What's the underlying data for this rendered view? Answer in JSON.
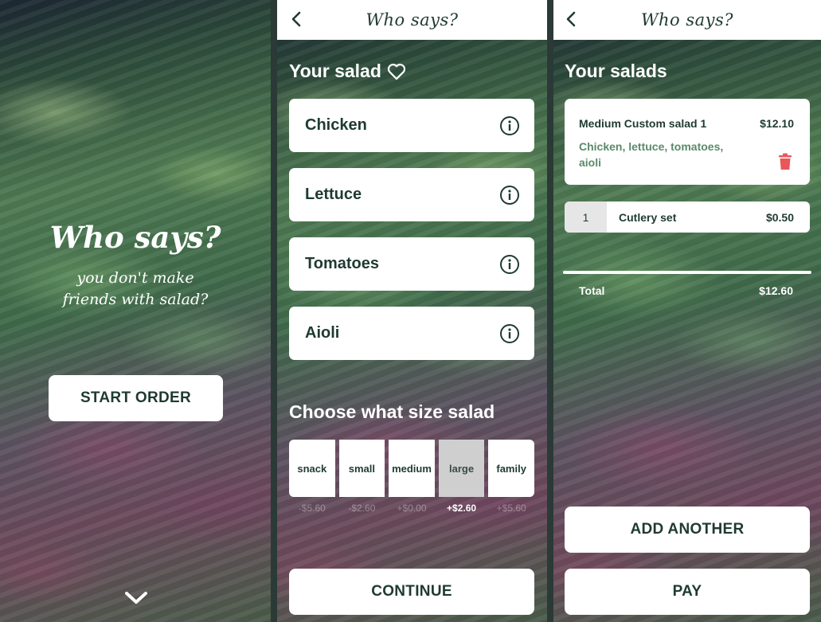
{
  "colors": {
    "brand_green": "#1f3a33",
    "card_white": "#ffffff",
    "selected_size_bg": "#cfcfcf",
    "desc_green": "#5a8a6a",
    "trash_red": "#e8575a"
  },
  "landing": {
    "title": "Who says?",
    "subtitle": "you don't make friends with salad?",
    "start_button": "START ORDER",
    "scroll_icon": "chevron-down-icon"
  },
  "builder": {
    "header_title": "Who says?",
    "back_icon": "chevron-left-icon",
    "section_title": "Your salad",
    "favorite_icon": "heart-outline-icon",
    "ingredients": [
      {
        "name": "Chicken",
        "icon": "info-icon"
      },
      {
        "name": "Lettuce",
        "icon": "info-icon"
      },
      {
        "name": "Tomatoes",
        "icon": "info-icon"
      },
      {
        "name": "Aioli",
        "icon": "info-icon"
      }
    ],
    "size_title": "Choose what size salad",
    "sizes": [
      {
        "label": "snack",
        "price": "-$5.60",
        "selected": false
      },
      {
        "label": "small",
        "price": "-$2.60",
        "selected": false
      },
      {
        "label": "medium",
        "price": "+$0.00",
        "selected": false
      },
      {
        "label": "large",
        "price": "+$2.60",
        "selected": true
      },
      {
        "label": "family",
        "price": "+$5.60",
        "selected": false
      }
    ],
    "continue_button": "CONTINUE"
  },
  "cart": {
    "header_title": "Who says?",
    "back_icon": "chevron-left-icon",
    "section_title": "Your salads",
    "item": {
      "name": "Medium Custom salad 1",
      "price": "$12.10",
      "description": "Chicken, lettuce, tomatoes, aioli",
      "delete_icon": "trash-icon"
    },
    "cutlery": {
      "quantity": "1",
      "name": "Cutlery set",
      "price": "$0.50"
    },
    "total_label": "Total",
    "total_value": "$12.60",
    "add_another_button": "ADD ANOTHER",
    "pay_button": "PAY"
  }
}
